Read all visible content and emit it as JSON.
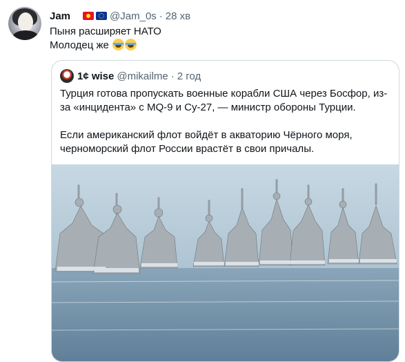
{
  "tweet": {
    "author_name": "Jam ",
    "handle": "@Jam_0s",
    "separator": "·",
    "time": "28 хв",
    "flags": [
      "flag-kg",
      "flag-eu"
    ],
    "lines": [
      "Пыня расширяет НАТО",
      "Молодец же"
    ],
    "emojis": [
      "rolling-on-floor-laughing-icon",
      "rolling-on-floor-laughing-icon"
    ]
  },
  "quoted": {
    "author_name": "1¢ wise",
    "handle": "@mikailme",
    "separator": "·",
    "time": "2 год",
    "paragraph1": "Турция готова пропускать военные корабли США через Босфор, из-за «инцидента» с MQ-9 и Су-27, — министр обороны Турции.",
    "paragraph2": "Если американский флот войдёт в акваторию Чёрного моря, черноморский флот России врастёт в свои причалы.",
    "image_subject": "warships-photo"
  },
  "colors": {
    "text": "#0f1419",
    "muted": "#536471",
    "border": "#cfd9de",
    "sky": "#b9cfdc",
    "sea": "#6f8ea6",
    "ship": "#9aa3aa"
  }
}
